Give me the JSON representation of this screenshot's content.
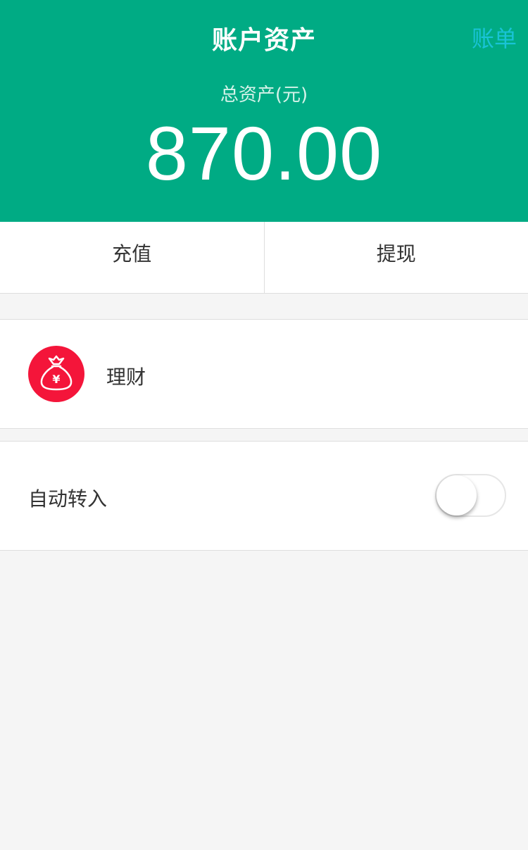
{
  "header": {
    "title": "账户资产",
    "bill_label": "账单",
    "total_label": "总资产(元)",
    "total_amount": "870.00"
  },
  "actions": {
    "recharge_label": "充值",
    "withdraw_label": "提现"
  },
  "licai": {
    "label": "理财",
    "icon": "money-bag-icon",
    "icon_glyph": "¥"
  },
  "auto_transfer": {
    "label": "自动转入",
    "enabled": false
  },
  "colors": {
    "header_bg": "#00ab84",
    "bill_link": "#19c3d6",
    "licai_icon_bg": "#f4153a"
  }
}
